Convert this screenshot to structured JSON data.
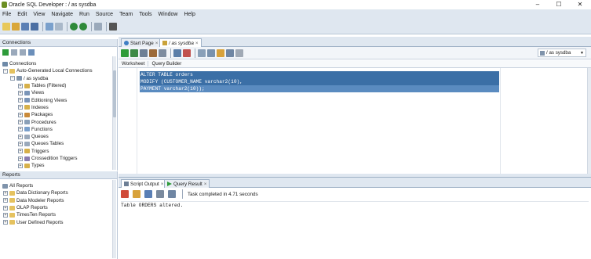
{
  "window": {
    "title": "Oracle SQL Developer : / as sysdba",
    "minimize": "–",
    "maximize": "☐",
    "close": "✕"
  },
  "menubar": {
    "items": [
      "File",
      "Edit",
      "View",
      "Navigate",
      "Run",
      "Source",
      "Team",
      "Tools",
      "Window",
      "Help"
    ]
  },
  "connections": {
    "header": "Connections",
    "root": "Connections",
    "auto": "Auto-Generated Local Connections",
    "conn": "/ as sysdba",
    "nodes": [
      "Tables (Filtered)",
      "Views",
      "Editioning Views",
      "Indexes",
      "Packages",
      "Procedures",
      "Functions",
      "Queues",
      "Queues Tables",
      "Triggers",
      "Crossedition Triggers",
      "Types"
    ]
  },
  "reports": {
    "header": "Reports",
    "items": [
      "All Reports",
      "Data Dictionary Reports",
      "Data Modeler Reports",
      "OLAP Reports",
      "TimesTen Reports",
      "User Defined Reports"
    ]
  },
  "editor": {
    "tabs": [
      {
        "label": "Start Page"
      },
      {
        "label": "/ as sysdba"
      }
    ],
    "connection_selector": "/ as sysdba",
    "subtabs": [
      "Worksheet",
      "Query Builder"
    ],
    "code": [
      "ALTER TABLE orders",
      "MODIFY (CUSTOMER_NAME varchar2(10),",
      "PAYMENT varchar2(10));"
    ]
  },
  "results": {
    "tabs": [
      "Script Output",
      "Query Result"
    ],
    "status": "Task completed in 4.71 seconds",
    "output": "Table ORDERS altered."
  }
}
